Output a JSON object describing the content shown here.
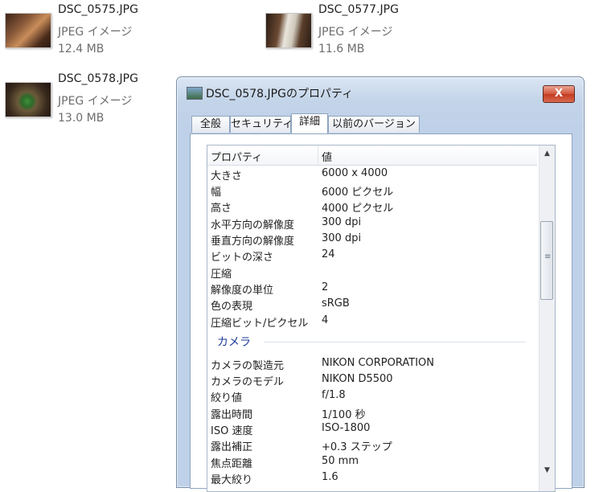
{
  "files": [
    {
      "name": "DSC_0575.JPG",
      "type": "JPEG イメージ",
      "size": "12.4 MB"
    },
    {
      "name": "DSC_0577.JPG",
      "type": "JPEG イメージ",
      "size": "11.6 MB"
    },
    {
      "name": "DSC_0578.JPG",
      "type": "JPEG イメージ",
      "size": "13.0 MB"
    }
  ],
  "dialog": {
    "title": "DSC_0578.JPGのプロパティ",
    "close_label": "X",
    "tabs": [
      "全般",
      "セキュリティ",
      "詳細",
      "以前のバージョン"
    ],
    "active_tab": "詳細",
    "header": {
      "property": "プロパティ",
      "value": "値"
    },
    "image_rows": [
      {
        "name": "大きさ",
        "value": "6000 x 4000"
      },
      {
        "name": "幅",
        "value": "6000 ピクセル"
      },
      {
        "name": "高さ",
        "value": "4000 ピクセル"
      },
      {
        "name": "水平方向の解像度",
        "value": "300 dpi"
      },
      {
        "name": "垂直方向の解像度",
        "value": "300 dpi"
      },
      {
        "name": "ビットの深さ",
        "value": "24"
      },
      {
        "name": "圧縮",
        "value": ""
      },
      {
        "name": "解像度の単位",
        "value": "2"
      },
      {
        "name": "色の表現",
        "value": "sRGB"
      },
      {
        "name": "圧縮ビット/ピクセル",
        "value": "4"
      }
    ],
    "camera_section": "カメラ",
    "camera_rows": [
      {
        "name": "カメラの製造元",
        "value": "NIKON CORPORATION"
      },
      {
        "name": "カメラのモデル",
        "value": "NIKON D5500"
      },
      {
        "name": "絞り値",
        "value": "f/1.8"
      },
      {
        "name": "露出時間",
        "value": "1/100 秒"
      },
      {
        "name": "ISO 速度",
        "value": "ISO-1800"
      },
      {
        "name": "露出補正",
        "value": "+0.3 ステップ"
      },
      {
        "name": "焦点距離",
        "value": "50 mm"
      },
      {
        "name": "最大絞り",
        "value": "1.6"
      }
    ],
    "scroll_up": "▲",
    "scroll_down": "▼"
  }
}
